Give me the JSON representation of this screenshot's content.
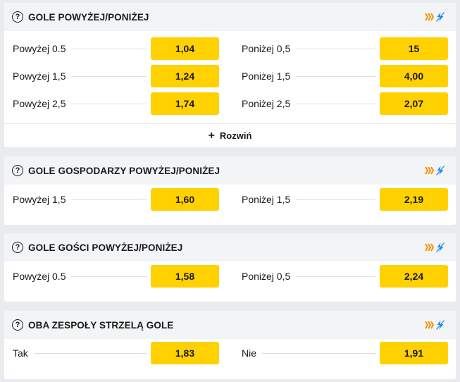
{
  "colors": {
    "odd_button": "#ffd100",
    "header_bg": "#f3f4f6",
    "page_bg": "#e9ebee",
    "stream_icon": "#f39200",
    "stats_icon": "#1e88e5"
  },
  "icons": {
    "help": "?",
    "stream": "live-stream-icon",
    "stats": "statistics-icon",
    "expand": "+"
  },
  "markets": [
    {
      "title": "GOLE POWYŻEJ/PONIŻEJ",
      "rows": [
        {
          "left": {
            "label": "Powyżej 0.5",
            "odd": "1,04"
          },
          "right": {
            "label": "Poniżej 0,5",
            "odd": "15"
          }
        },
        {
          "left": {
            "label": "Powyżej 1,5",
            "odd": "1,24"
          },
          "right": {
            "label": "Poniżej 1,5",
            "odd": "4,00"
          }
        },
        {
          "left": {
            "label": "Powyżej 2,5",
            "odd": "1,74"
          },
          "right": {
            "label": "Poniżej 2,5",
            "odd": "2,07"
          }
        }
      ],
      "expand_label": "Rozwiń"
    },
    {
      "title": "GOLE GOSPODARZY POWYŻEJ/PONIŻEJ",
      "rows": [
        {
          "left": {
            "label": "Powyżej 1,5",
            "odd": "1,60"
          },
          "right": {
            "label": "Poniżej 1,5",
            "odd": "2,19"
          }
        }
      ]
    },
    {
      "title": "GOLE GOŚCI POWYŻEJ/PONIŻEJ",
      "rows": [
        {
          "left": {
            "label": "Powyżej 0.5",
            "odd": "1,58"
          },
          "right": {
            "label": "Poniżej 0,5",
            "odd": "2,24"
          }
        }
      ]
    },
    {
      "title": "OBA ZESPOŁY STRZELĄ GOLE",
      "rows": [
        {
          "left": {
            "label": "Tak",
            "odd": "1,83"
          },
          "right": {
            "label": "Nie",
            "odd": "1,91"
          }
        }
      ]
    }
  ]
}
